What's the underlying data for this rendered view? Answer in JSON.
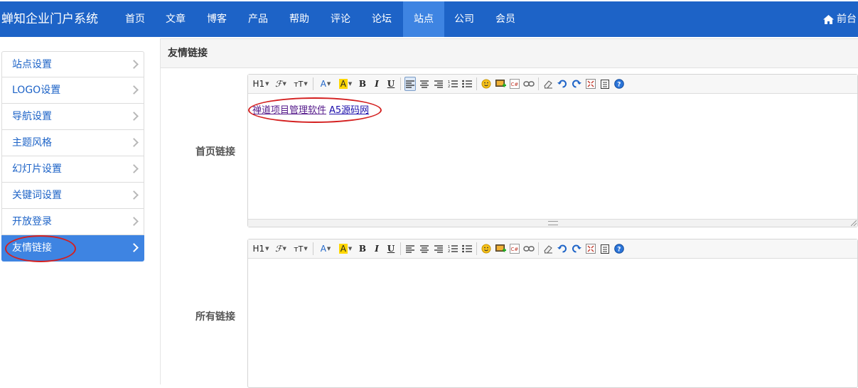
{
  "header": {
    "brand": "蝉知企业门户系统",
    "nav": [
      "首页",
      "文章",
      "博客",
      "产品",
      "帮助",
      "评论",
      "论坛",
      "站点",
      "公司",
      "会员"
    ],
    "active_nav": "站点",
    "front_label": "前台",
    "front_icon": "home-icon"
  },
  "sidebar": {
    "items": [
      {
        "label": "站点设置"
      },
      {
        "label": "LOGO设置"
      },
      {
        "label": "导航设置"
      },
      {
        "label": "主题风格"
      },
      {
        "label": "幻灯片设置"
      },
      {
        "label": "关键词设置"
      },
      {
        "label": "开放登录"
      },
      {
        "label": "友情链接"
      }
    ],
    "active": "友情链接"
  },
  "main": {
    "title": "友情链接",
    "home_links": {
      "label": "首页链接",
      "links": [
        "禅道项目管理软件",
        "A5源码网"
      ]
    },
    "all_links": {
      "label": "所有链接"
    }
  },
  "toolbar": {
    "heading": "H1",
    "font": "ℱ",
    "size": "тT",
    "forecolor": "A",
    "backcolor": "A",
    "bold": "B",
    "italic": "I",
    "underline": "U"
  },
  "colors": {
    "nav_bg": "#1d63c7",
    "nav_active": "#3e84e2",
    "annotation": "#d42020",
    "highlight": "#ffd700"
  }
}
